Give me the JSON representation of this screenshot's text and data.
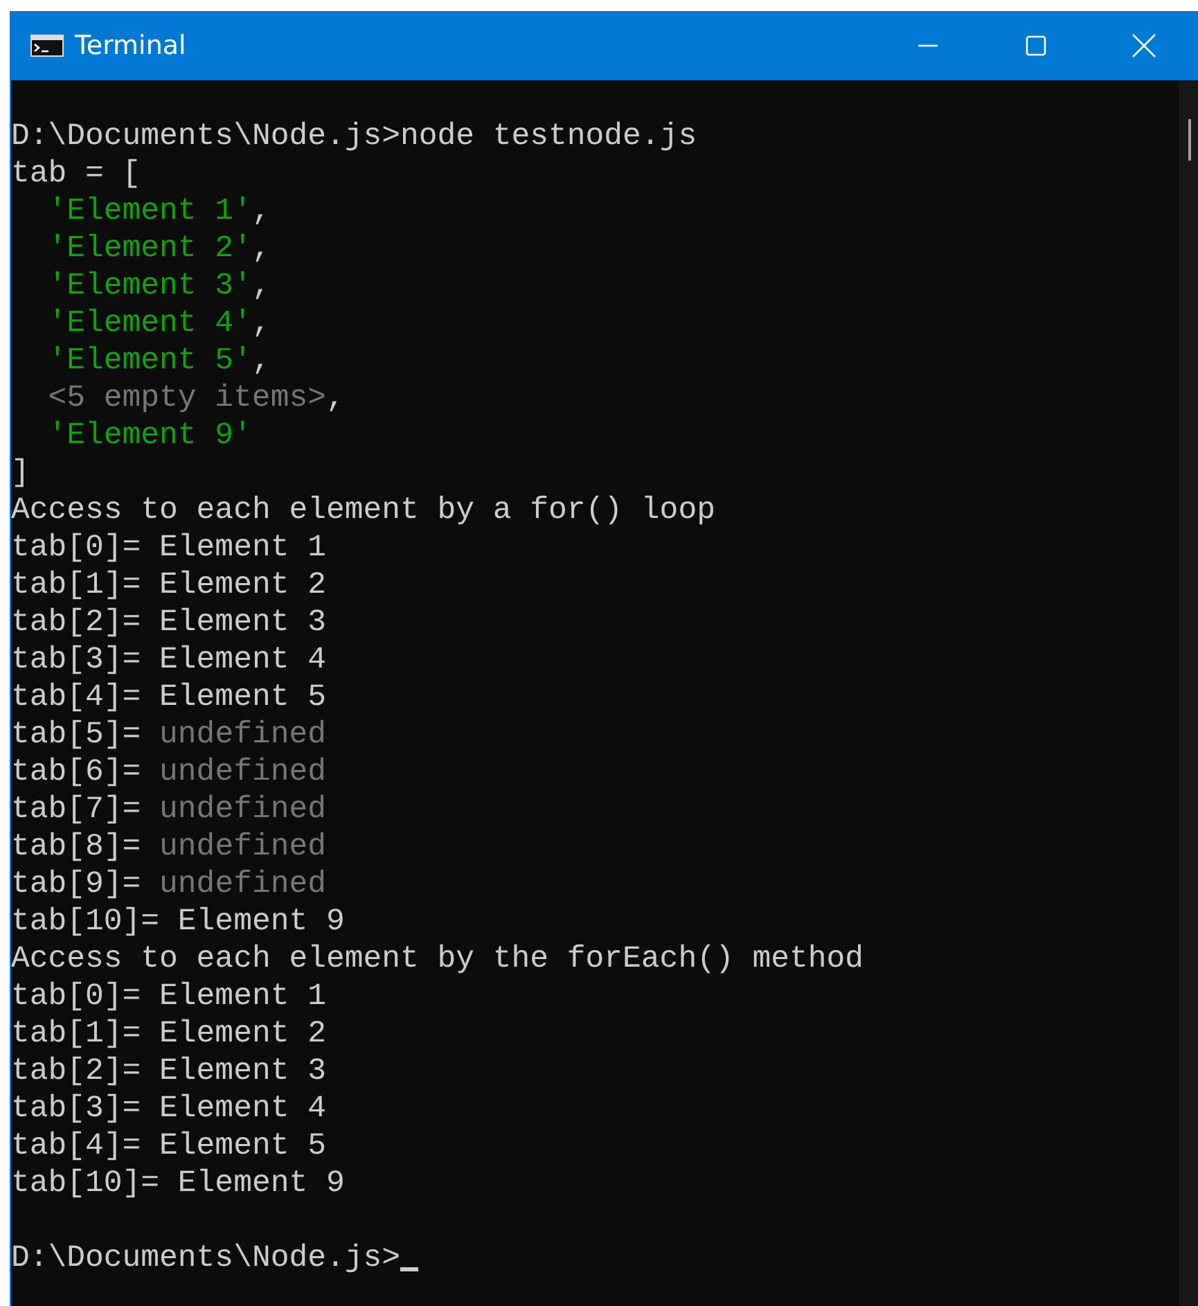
{
  "window": {
    "title": "Terminal"
  },
  "terminal": {
    "lines": [
      {
        "kind": "blank"
      },
      {
        "kind": "text",
        "indented": false,
        "segments": [
          {
            "kind": "plain",
            "text": "D:\\Documents\\Node.js>node testnode.js"
          }
        ]
      },
      {
        "kind": "text",
        "indented": false,
        "segments": [
          {
            "kind": "plain",
            "text": "tab = ["
          }
        ]
      },
      {
        "kind": "text",
        "indented": true,
        "segments": [
          {
            "kind": "string",
            "text": "'Element 1'"
          },
          {
            "kind": "plain",
            "text": ","
          }
        ]
      },
      {
        "kind": "text",
        "indented": true,
        "segments": [
          {
            "kind": "string",
            "text": "'Element 2'"
          },
          {
            "kind": "plain",
            "text": ","
          }
        ]
      },
      {
        "kind": "text",
        "indented": true,
        "segments": [
          {
            "kind": "string",
            "text": "'Element 3'"
          },
          {
            "kind": "plain",
            "text": ","
          }
        ]
      },
      {
        "kind": "text",
        "indented": true,
        "segments": [
          {
            "kind": "string",
            "text": "'Element 4'"
          },
          {
            "kind": "plain",
            "text": ","
          }
        ]
      },
      {
        "kind": "text",
        "indented": true,
        "segments": [
          {
            "kind": "string",
            "text": "'Element 5'"
          },
          {
            "kind": "plain",
            "text": ","
          }
        ]
      },
      {
        "kind": "text",
        "indented": true,
        "segments": [
          {
            "kind": "dim",
            "text": "<5 empty items>"
          },
          {
            "kind": "plain",
            "text": ","
          }
        ]
      },
      {
        "kind": "text",
        "indented": true,
        "segments": [
          {
            "kind": "string",
            "text": "'Element 9'"
          }
        ]
      },
      {
        "kind": "text",
        "indented": false,
        "segments": [
          {
            "kind": "plain",
            "text": "]"
          }
        ]
      },
      {
        "kind": "text",
        "indented": false,
        "segments": [
          {
            "kind": "plain",
            "text": "Access to each element by a for() loop"
          }
        ]
      },
      {
        "kind": "text",
        "indented": false,
        "segments": [
          {
            "kind": "plain",
            "text": "tab[0]= Element 1"
          }
        ]
      },
      {
        "kind": "text",
        "indented": false,
        "segments": [
          {
            "kind": "plain",
            "text": "tab[1]= Element 2"
          }
        ]
      },
      {
        "kind": "text",
        "indented": false,
        "segments": [
          {
            "kind": "plain",
            "text": "tab[2]= Element 3"
          }
        ]
      },
      {
        "kind": "text",
        "indented": false,
        "segments": [
          {
            "kind": "plain",
            "text": "tab[3]= Element 4"
          }
        ]
      },
      {
        "kind": "text",
        "indented": false,
        "segments": [
          {
            "kind": "plain",
            "text": "tab[4]= Element 5"
          }
        ]
      },
      {
        "kind": "text",
        "indented": false,
        "segments": [
          {
            "kind": "plain",
            "text": "tab[5]= "
          },
          {
            "kind": "dim",
            "text": "undefined"
          }
        ]
      },
      {
        "kind": "text",
        "indented": false,
        "segments": [
          {
            "kind": "plain",
            "text": "tab[6]= "
          },
          {
            "kind": "dim",
            "text": "undefined"
          }
        ]
      },
      {
        "kind": "text",
        "indented": false,
        "segments": [
          {
            "kind": "plain",
            "text": "tab[7]= "
          },
          {
            "kind": "dim",
            "text": "undefined"
          }
        ]
      },
      {
        "kind": "text",
        "indented": false,
        "segments": [
          {
            "kind": "plain",
            "text": "tab[8]= "
          },
          {
            "kind": "dim",
            "text": "undefined"
          }
        ]
      },
      {
        "kind": "text",
        "indented": false,
        "segments": [
          {
            "kind": "plain",
            "text": "tab[9]= "
          },
          {
            "kind": "dim",
            "text": "undefined"
          }
        ]
      },
      {
        "kind": "text",
        "indented": false,
        "segments": [
          {
            "kind": "plain",
            "text": "tab[10]= Element 9"
          }
        ]
      },
      {
        "kind": "text",
        "indented": false,
        "segments": [
          {
            "kind": "plain",
            "text": "Access to each element by the forEach() method"
          }
        ]
      },
      {
        "kind": "text",
        "indented": false,
        "segments": [
          {
            "kind": "plain",
            "text": "tab[0]= Element 1"
          }
        ]
      },
      {
        "kind": "text",
        "indented": false,
        "segments": [
          {
            "kind": "plain",
            "text": "tab[1]= Element 2"
          }
        ]
      },
      {
        "kind": "text",
        "indented": false,
        "segments": [
          {
            "kind": "plain",
            "text": "tab[2]= Element 3"
          }
        ]
      },
      {
        "kind": "text",
        "indented": false,
        "segments": [
          {
            "kind": "plain",
            "text": "tab[3]= Element 4"
          }
        ]
      },
      {
        "kind": "text",
        "indented": false,
        "segments": [
          {
            "kind": "plain",
            "text": "tab[4]= Element 5"
          }
        ]
      },
      {
        "kind": "text",
        "indented": false,
        "segments": [
          {
            "kind": "plain",
            "text": "tab[10]= Element 9"
          }
        ]
      },
      {
        "kind": "blank"
      },
      {
        "kind": "prompt",
        "indented": false,
        "segments": [
          {
            "kind": "plain",
            "text": "D:\\Documents\\Node.js>"
          }
        ]
      }
    ]
  }
}
